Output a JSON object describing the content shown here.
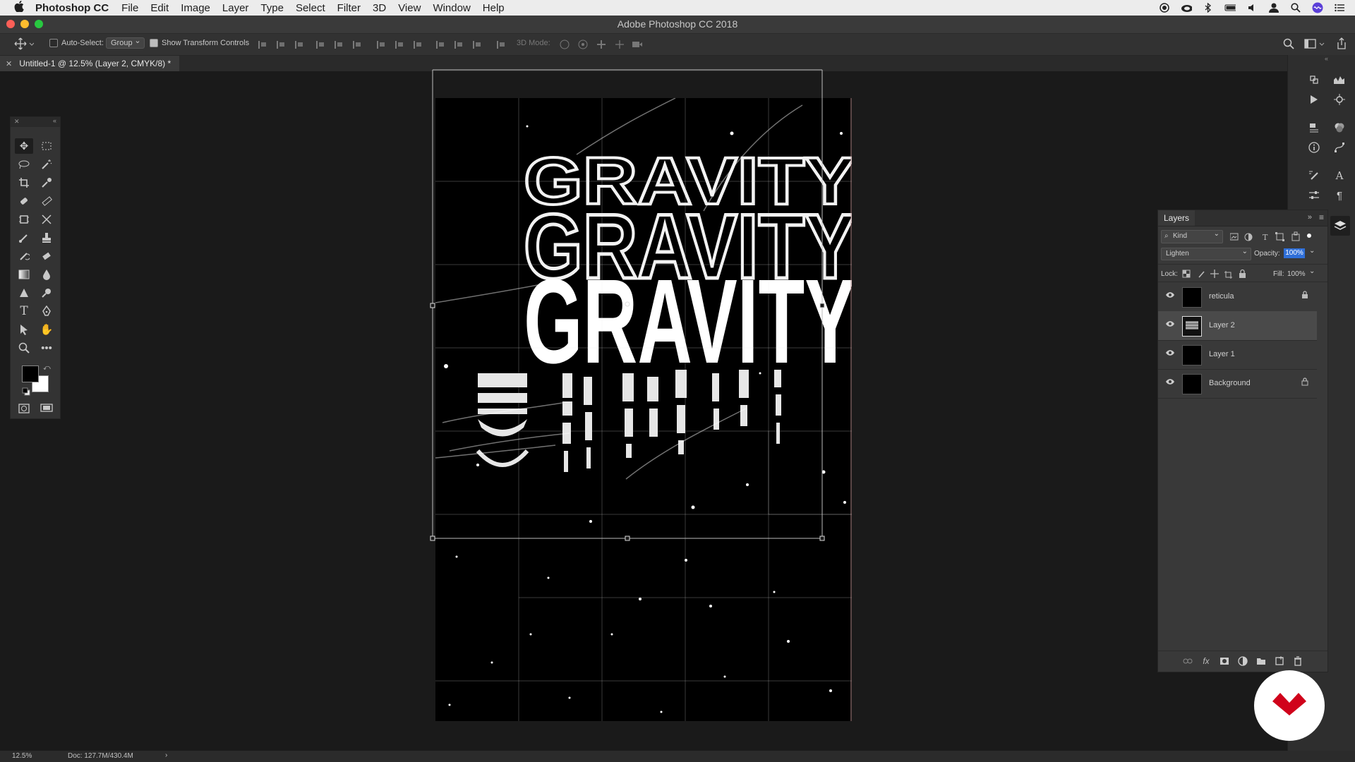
{
  "menubar": {
    "app_name": "Photoshop CC",
    "items": [
      "File",
      "Edit",
      "Image",
      "Layer",
      "Type",
      "Select",
      "Filter",
      "3D",
      "View",
      "Window",
      "Help"
    ]
  },
  "window": {
    "title": "Adobe Photoshop CC 2018"
  },
  "options": {
    "auto_select_label": "Auto-Select:",
    "auto_select_value": "Group",
    "transform_label": "Show Transform Controls",
    "mode_3d_label": "3D Mode:"
  },
  "document": {
    "tab_label": "Untitled-1 @ 12.5% (Layer 2, CMYK/8) *",
    "artwork_text": "GRAVITY"
  },
  "layers_panel": {
    "title": "Layers",
    "filter_kind": "Kind",
    "blend_mode": "Lighten",
    "opacity_label": "Opacity:",
    "opacity_value": "100%",
    "lock_label": "Lock:",
    "fill_label": "Fill:",
    "fill_value": "100%",
    "layers": [
      {
        "name": "reticula",
        "locked": true
      },
      {
        "name": "Layer 2",
        "locked": false,
        "selected": true
      },
      {
        "name": "Layer 1",
        "locked": false
      },
      {
        "name": "Background",
        "locked": true
      }
    ]
  },
  "status": {
    "zoom": "12.5%",
    "doc_size": "Doc: 127.7M/430.4M"
  },
  "colors": {
    "foreground": "#000000",
    "background": "#ffffff",
    "badge_accent": "#d0021b"
  }
}
